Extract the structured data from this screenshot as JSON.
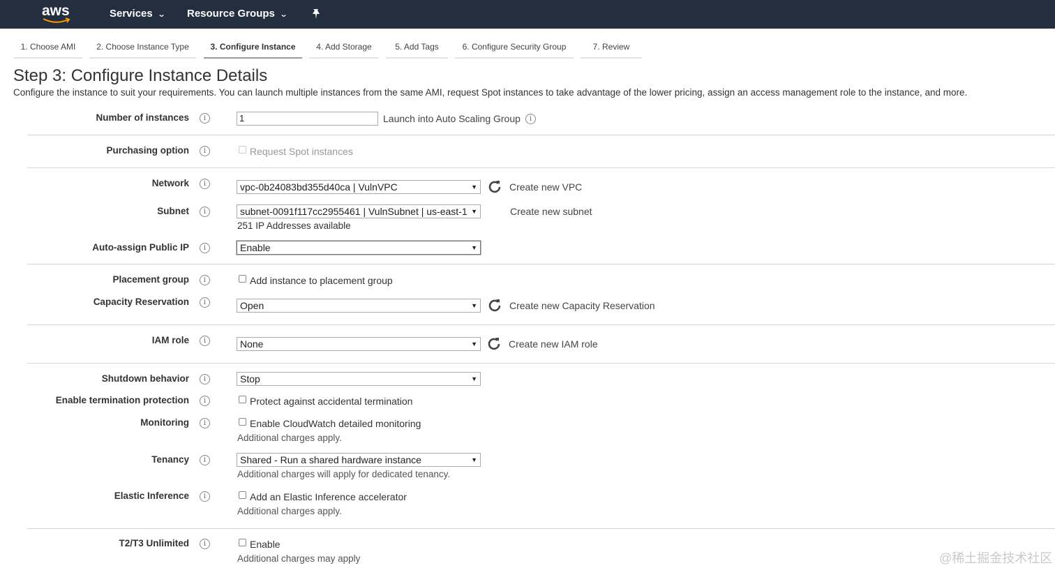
{
  "topbar": {
    "logo_text": "aws",
    "services_label": "Services",
    "resource_groups_label": "Resource Groups",
    "chevron": "⌄",
    "pin_icon": "pin-icon"
  },
  "steps": [
    {
      "label": "1. Choose AMI"
    },
    {
      "label": "2. Choose Instance Type"
    },
    {
      "label": "3. Configure Instance"
    },
    {
      "label": "4. Add Storage"
    },
    {
      "label": "5. Add Tags"
    },
    {
      "label": "6. Configure Security Group"
    },
    {
      "label": "7. Review"
    }
  ],
  "active_step_index": 2,
  "page": {
    "title": "Step 3: Configure Instance Details",
    "description": "Configure the instance to suit your requirements. You can launch multiple instances from the same AMI, request Spot instances to take advantage of the lower pricing, assign an access management role to the instance, and more."
  },
  "form": {
    "number_of_instances": {
      "label": "Number of instances",
      "value": "1",
      "link": "Launch into Auto Scaling Group"
    },
    "purchasing_option": {
      "label": "Purchasing option",
      "checkbox_label": "Request Spot instances",
      "checked": false,
      "disabled": true
    },
    "network": {
      "label": "Network",
      "value": "vpc-0b24083bd355d40ca | VulnVPC",
      "link": "Create new VPC"
    },
    "subnet": {
      "label": "Subnet",
      "value": "subnet-0091f117cc2955461 | VulnSubnet | us-east-1",
      "note": "251 IP Addresses available",
      "link": "Create new subnet"
    },
    "auto_assign_ip": {
      "label": "Auto-assign Public IP",
      "value": "Enable"
    },
    "placement_group": {
      "label": "Placement group",
      "checkbox_label": "Add instance to placement group",
      "checked": false
    },
    "capacity_reservation": {
      "label": "Capacity Reservation",
      "value": "Open",
      "link": "Create new Capacity Reservation"
    },
    "iam_role": {
      "label": "IAM role",
      "value": "None",
      "link": "Create new IAM role"
    },
    "shutdown_behavior": {
      "label": "Shutdown behavior",
      "value": "Stop"
    },
    "termination_protection": {
      "label": "Enable termination protection",
      "checkbox_label": "Protect against accidental termination",
      "checked": false
    },
    "monitoring": {
      "label": "Monitoring",
      "checkbox_label": "Enable CloudWatch detailed monitoring",
      "checked": false,
      "note": "Additional charges apply."
    },
    "tenancy": {
      "label": "Tenancy",
      "value": "Shared - Run a shared hardware instance",
      "note": "Additional charges will apply for dedicated tenancy."
    },
    "elastic_inference": {
      "label": "Elastic Inference",
      "checkbox_label": "Add an Elastic Inference accelerator",
      "checked": false,
      "note": "Additional charges apply."
    },
    "t2t3_unlimited": {
      "label": "T2/T3 Unlimited",
      "checkbox_label": "Enable",
      "checked": false,
      "note": "Additional charges may apply"
    }
  },
  "icons": {
    "info": "i",
    "select_arrow": "▼"
  },
  "colors": {
    "topbar": "#232f3e",
    "text": "#333333",
    "rule": "#d5d5d5"
  },
  "watermark": "@稀土掘金技术社区"
}
